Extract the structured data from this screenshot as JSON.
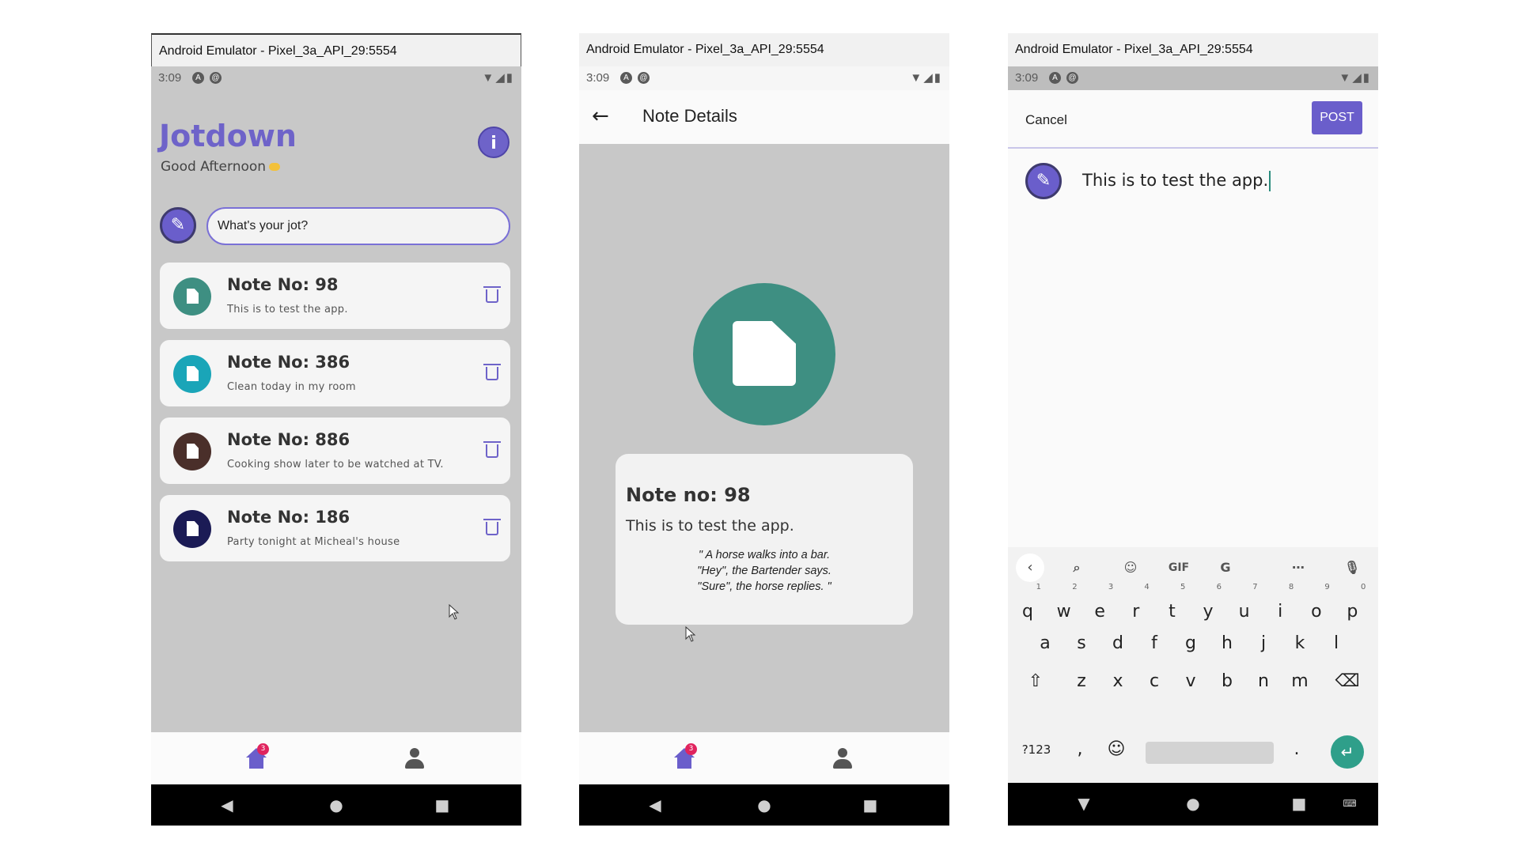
{
  "emulator_title": "Android Emulator - Pixel_3a_API_29:5554",
  "status_time": "3:09",
  "home_badge": "3",
  "screen1": {
    "app_name": "Jotdown",
    "greeting": "Good Afternoon",
    "input_value": "What's your jot?",
    "notes": [
      {
        "title": "Note No: 98",
        "subtitle": "This is to test the app.",
        "color": "#3e8f82"
      },
      {
        "title": "Note No: 386",
        "subtitle": "Clean today in my room",
        "color": "#1aa5b8"
      },
      {
        "title": "Note No: 886",
        "subtitle": "Cooking show later to be watched at TV.",
        "color": "#4a2f2a"
      },
      {
        "title": "Note No: 186",
        "subtitle": "Party tonight at Micheal's house",
        "color": "#1b1b55"
      }
    ]
  },
  "screen2": {
    "title": "Note Details",
    "note_title": "Note no: 98",
    "note_body": "This is to test the app.",
    "quote_lines": [
      "\" A horse walks into a bar.",
      "\"Hey\", the Bartender says.",
      "\"Sure\", the horse replies. \""
    ]
  },
  "screen3": {
    "cancel_label": "Cancel",
    "post_label": "POST",
    "post_text": "This is to test the app.",
    "keyboard": {
      "gif_label": "GIF",
      "row1": [
        {
          "k": "q",
          "n": "1"
        },
        {
          "k": "w",
          "n": "2"
        },
        {
          "k": "e",
          "n": "3"
        },
        {
          "k": "r",
          "n": "4"
        },
        {
          "k": "t",
          "n": "5"
        },
        {
          "k": "y",
          "n": "6"
        },
        {
          "k": "u",
          "n": "7"
        },
        {
          "k": "i",
          "n": "8"
        },
        {
          "k": "o",
          "n": "9"
        },
        {
          "k": "p",
          "n": "0"
        }
      ],
      "row2": [
        "a",
        "s",
        "d",
        "f",
        "g",
        "h",
        "j",
        "k",
        "l"
      ],
      "row3": [
        "z",
        "x",
        "c",
        "v",
        "b",
        "n",
        "m"
      ],
      "symbols_label": "?123",
      "comma": ",",
      "period": "."
    }
  }
}
